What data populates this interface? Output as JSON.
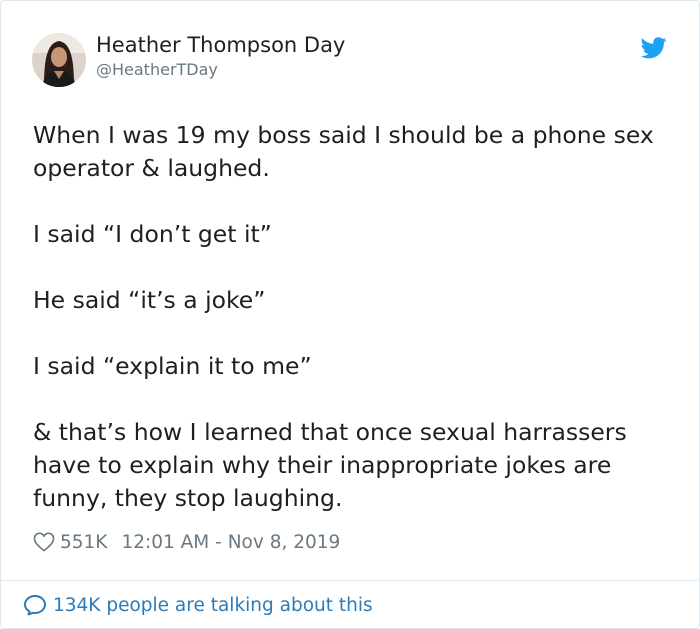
{
  "author": {
    "name": "Heather Thompson Day",
    "handle": "@HeatherTDay"
  },
  "icons": {
    "platform": "twitter-bird-icon",
    "like": "heart-icon",
    "conversation": "speech-bubble-icon"
  },
  "colors": {
    "brand": "#1da1f2",
    "link": "#2b7bb9",
    "secondary_text": "#697882"
  },
  "tweet": {
    "paragraphs": [
      "When I was 19 my boss said I should be a phone sex",
      "operator & laughed.",
      "I said “I don’t get it”",
      "He said “it’s a joke”",
      "I said “explain it to me”",
      "& that’s how I learned that once sexual harrassers",
      "have to explain why their inappropriate jokes are",
      "funny, they stop laughing."
    ]
  },
  "meta": {
    "likes": "551K",
    "timestamp": "12:01 AM - Nov 8, 2019"
  },
  "footer": {
    "conversation_text": "134K people are talking about this"
  }
}
